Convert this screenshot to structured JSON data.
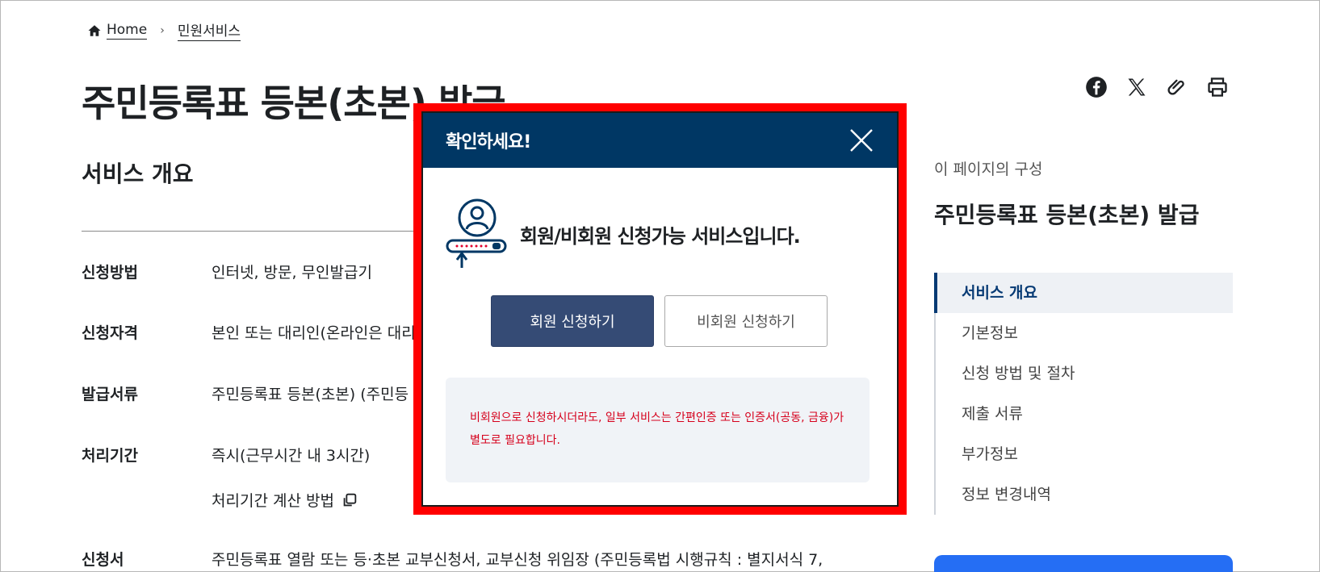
{
  "breadcrumb": {
    "home": "Home",
    "current": "민원서비스"
  },
  "page_title": "주민등록표 등본(초본) 발급",
  "section_title": "서비스 개요",
  "info_rows": [
    {
      "key": "신청방법",
      "value": "인터넷, 방문, 무인발급기"
    },
    {
      "key": "신청자격",
      "value": "본인 또는 대리인(온라인은 대리"
    },
    {
      "key": "발급서류",
      "value": "주민등록표 등본(초본) (주민등"
    },
    {
      "key": "처리기간",
      "value": "즉시(근무시간 내 3시간)"
    },
    {
      "key": "신청서",
      "value": "주민등록표 열람 또는 등·초본 교부신청서, 교부신청 위임장 (주민등록법 시행규칙 : 별지서식 7,"
    }
  ],
  "processing_link": "처리기간 계산 방법",
  "share_icons": [
    "facebook-icon",
    "x-icon",
    "attach-icon",
    "print-icon"
  ],
  "toc": {
    "caption": "이 페이지의 구성",
    "title": "주민등록표 등본(초본) 발급",
    "items": [
      "서비스 개요",
      "기본정보",
      "신청 방법 및 절차",
      "제출 서류",
      "부가정보",
      "정보 변경내역"
    ]
  },
  "modal": {
    "title": "확인하세요!",
    "message": "회원/비회원 신청가능 서비스입니다.",
    "member_button": "회원 신청하기",
    "guest_button": "비회원 신청하기",
    "notice_line1": "비회원으로 신청하시더라도, 일부 서비스는 간편인증 또는 인증서(공동, 금융)가",
    "notice_line2": "별도로 필요합니다."
  },
  "colors": {
    "header_navy": "#003764",
    "member_button": "#354b75",
    "notice_red": "#d6001c",
    "highlight_outline": "#ff0000",
    "accent_blue": "#256ef4"
  }
}
